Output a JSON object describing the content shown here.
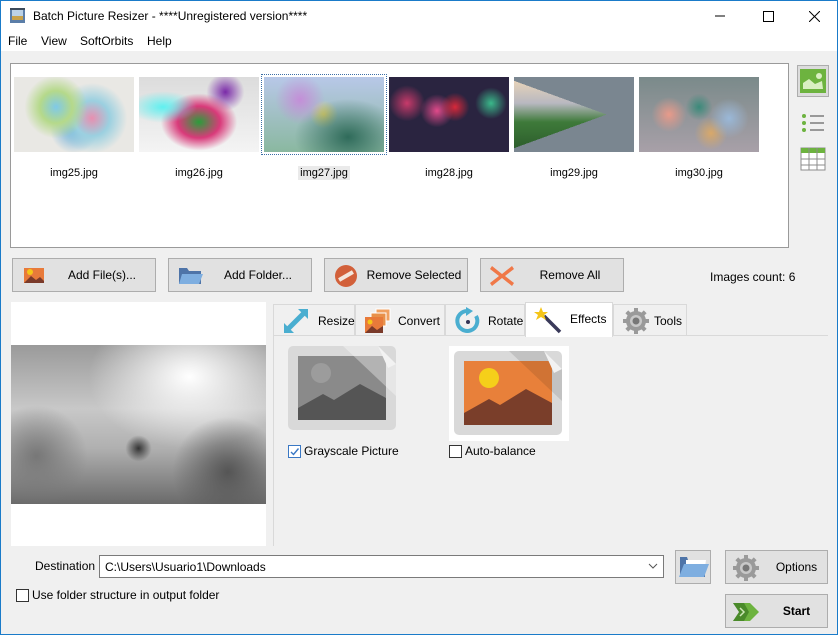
{
  "window": {
    "title": "Batch Picture Resizer - ****Unregistered version****",
    "controls": {
      "minimize": "minimize-icon",
      "maximize": "maximize-icon",
      "close": "close-icon"
    }
  },
  "menu": [
    "File",
    "View",
    "SoftOrbits",
    "Help"
  ],
  "thumbnails": [
    {
      "name": "img25.jpg",
      "selected": false
    },
    {
      "name": "img26.jpg",
      "selected": false
    },
    {
      "name": "img27.jpg",
      "selected": true
    },
    {
      "name": "img28.jpg",
      "selected": false
    },
    {
      "name": "img29.jpg",
      "selected": false
    },
    {
      "name": "img30.jpg",
      "selected": false
    }
  ],
  "view_modes": [
    {
      "icon": "thumbnail-view-icon",
      "active": true
    },
    {
      "icon": "list-view-icon",
      "active": false
    },
    {
      "icon": "table-view-icon",
      "active": false
    }
  ],
  "toolbar": {
    "add_files": "Add File(s)...",
    "add_folder": "Add Folder...",
    "remove_selected": "Remove Selected",
    "remove_all": "Remove All",
    "images_count": "Images count: 6"
  },
  "tabs": [
    {
      "label": "Resize",
      "icon": "resize-arrow-icon",
      "active": false
    },
    {
      "label": "Convert",
      "icon": "convert-images-icon",
      "active": false
    },
    {
      "label": "Rotate",
      "icon": "rotate-icon",
      "active": false
    },
    {
      "label": "Effects",
      "icon": "magic-wand-icon",
      "active": true
    },
    {
      "label": "Tools",
      "icon": "gear-icon",
      "active": false
    }
  ],
  "effects": [
    {
      "label": "Grayscale Picture",
      "checked": true
    },
    {
      "label": "Auto-balance",
      "checked": false
    }
  ],
  "destination": {
    "label": "Destination",
    "value": "C:\\Users\\Usuario1\\Downloads"
  },
  "use_folder_structure": {
    "label": "Use folder structure in output folder",
    "checked": false
  },
  "options_label": "Options",
  "start_label": "Start",
  "colors": {
    "accent_green": "#6db33f",
    "window_border": "#1a7bc9",
    "remove_orange": "#e0623a"
  }
}
